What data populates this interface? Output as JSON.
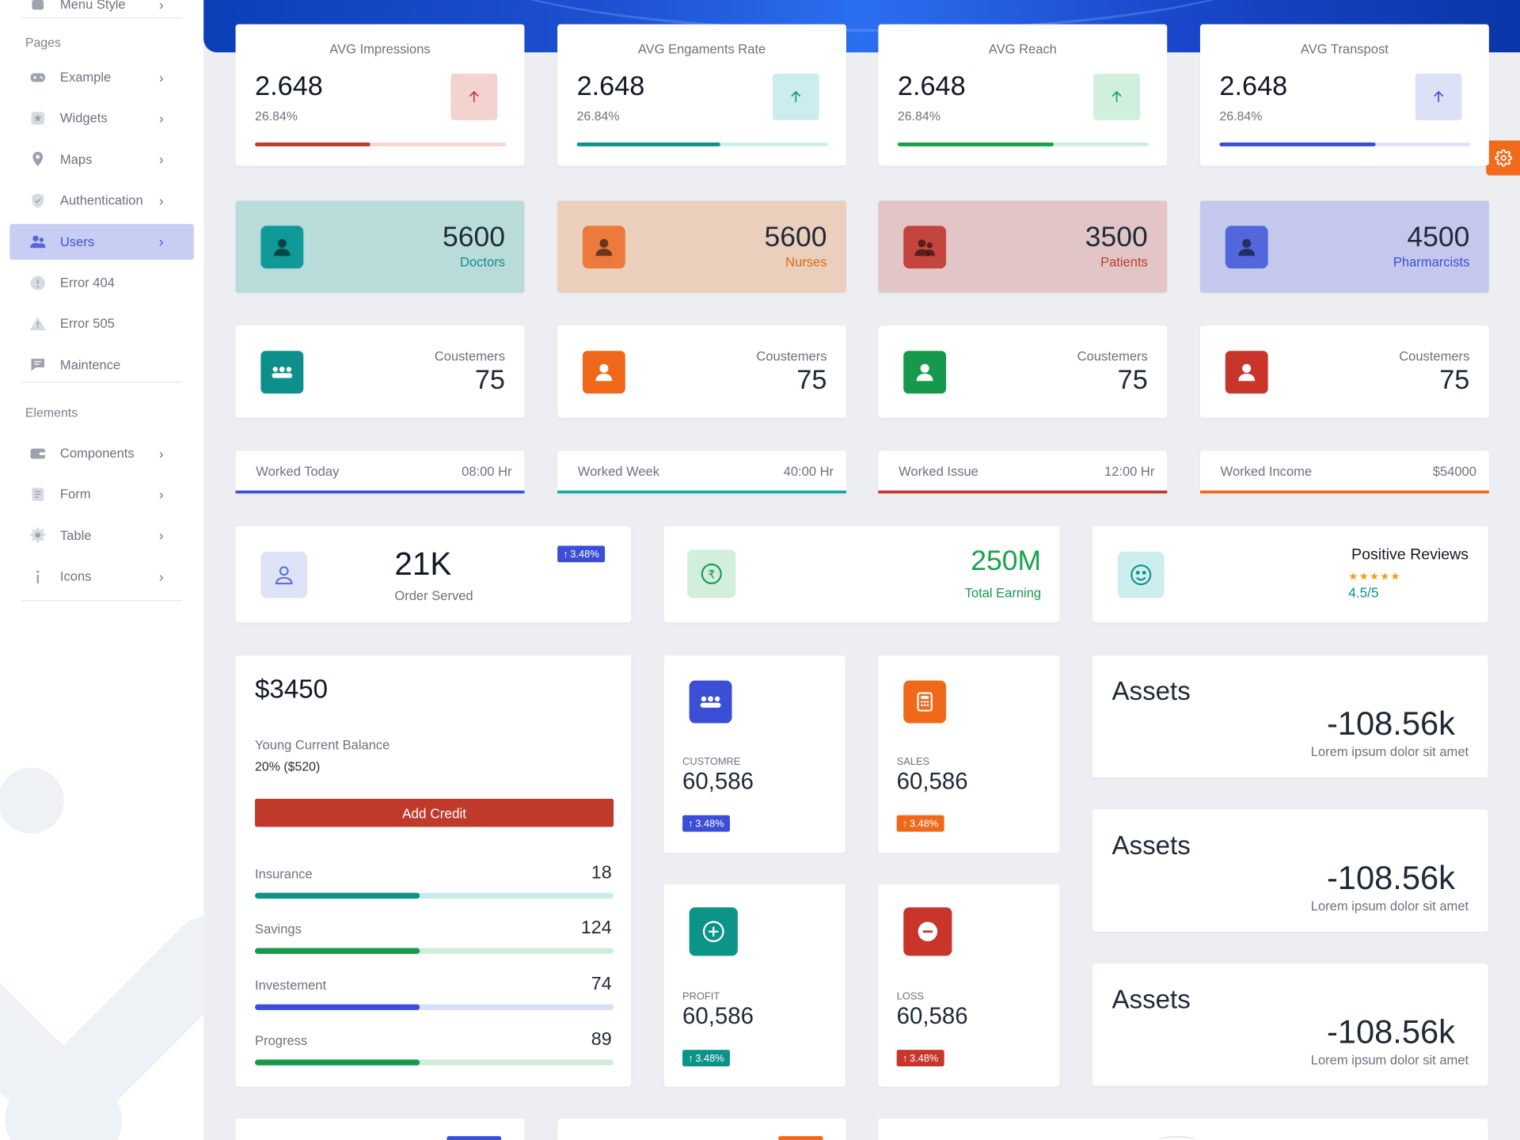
{
  "sidebar": {
    "partial_item": "Menu Style",
    "section_pages": "Pages",
    "section_elements": "Elements",
    "pages_items": [
      {
        "label": "Example",
        "icon": "gamepad-icon"
      },
      {
        "label": "Widgets",
        "icon": "star-box-icon"
      },
      {
        "label": "Maps",
        "icon": "map-pin-icon"
      },
      {
        "label": "Authentication",
        "icon": "shield-icon"
      },
      {
        "label": "Users",
        "icon": "users-icon",
        "active": true
      },
      {
        "label": "Error 404",
        "icon": "alert-circle-icon"
      },
      {
        "label": "Error 505",
        "icon": "warning-triangle-icon"
      },
      {
        "label": "Maintence",
        "icon": "chat-bubble-icon"
      }
    ],
    "element_items": [
      {
        "label": "Components",
        "icon": "wallet-icon"
      },
      {
        "label": "Form",
        "icon": "form-icon"
      },
      {
        "label": "Table",
        "icon": "gear-icon"
      },
      {
        "label": "Icons",
        "icon": "info-icon"
      }
    ]
  },
  "avg_cards": [
    {
      "title": "AVG Impressions",
      "value": "2.648",
      "percent": "26.84%",
      "progress": 0.46,
      "color": "#c0392b",
      "track": "#f6d7d2",
      "icon_bg": "#f3d3d0"
    },
    {
      "title": "AVG Engaments Rate",
      "value": "2.648",
      "percent": "26.84%",
      "progress": 0.57,
      "color": "#0d9488",
      "track": "#cdeeee",
      "icon_bg": "#cceded"
    },
    {
      "title": "AVG Reach",
      "value": "2.648",
      "percent": "26.84%",
      "progress": 0.62,
      "color": "#16a34a",
      "track": "#d0eedb",
      "icon_bg": "#d1efdd"
    },
    {
      "title": "AVG Transpost",
      "value": "2.648",
      "percent": "26.84%",
      "progress": 0.62,
      "color": "#3b4fd6",
      "track": "#dfe3f8",
      "icon_bg": "#dde1f8"
    }
  ],
  "count_cards": [
    {
      "count": "5600",
      "label": "Doctors",
      "bg": "#b9dcdb",
      "icon_bg": "#0f9a97",
      "label_color": "#0f8c8a",
      "icon": "user-icon"
    },
    {
      "count": "5600",
      "label": "Nurses",
      "bg": "#ebcfbd",
      "icon_bg": "#ec7a3d",
      "label_color": "#e2670d",
      "icon": "user-icon"
    },
    {
      "count": "3500",
      "label": "Patients",
      "bg": "#e2c6c7",
      "icon_bg": "#c4453d",
      "label_color": "#c0392b",
      "icon": "users-icon"
    },
    {
      "count": "4500",
      "label": "Pharmarcists",
      "bg": "#c3c8ec",
      "icon_bg": "#5367dd",
      "label_color": "#3b4fd6",
      "icon": "user-icon"
    }
  ],
  "customer_cards": [
    {
      "label": "Coustemers",
      "value": "75",
      "icon_bg": "#0d8f8c",
      "icon": "group-icon"
    },
    {
      "label": "Coustemers",
      "value": "75",
      "icon_bg": "#f0691a",
      "icon": "user-icon"
    },
    {
      "label": "Coustemers",
      "value": "75",
      "icon_bg": "#16994b",
      "icon": "user-icon"
    },
    {
      "label": "Coustemers",
      "value": "75",
      "icon_bg": "#c7352b",
      "icon": "user-icon"
    }
  ],
  "worked_cards": [
    {
      "label": "Worked Today",
      "value": "08:00 Hr",
      "color": "#3b4fd6"
    },
    {
      "label": "Worked Week",
      "value": "40:00 Hr",
      "color": "#17a8a8"
    },
    {
      "label": "Worked Issue",
      "value": "12:00 Hr",
      "color": "#c0392b"
    },
    {
      "label": "Worked Income",
      "value": "$54000",
      "color": "#f06a1b"
    }
  ],
  "order_card": {
    "value": "21K",
    "label": "Order Served",
    "badge": "3.48%"
  },
  "earning_card": {
    "value": "250M",
    "label": "Total Earning"
  },
  "review_card": {
    "title": "Positive Reviews",
    "stars": "★★★★★",
    "rating": "4.5/5"
  },
  "balance_card": {
    "amount": "$3450",
    "label": "Young Current Balance",
    "sub": "20% ($520)",
    "button": "Add Credit",
    "metrics": [
      {
        "label": "Insurance",
        "value": "18",
        "progress": 0.46,
        "color": "#0d9488",
        "track": "#c9ecec"
      },
      {
        "label": "Savings",
        "value": "124",
        "progress": 0.46,
        "color": "#16994b",
        "track": "#cdeedb"
      },
      {
        "label": "Investement",
        "value": "74",
        "progress": 0.46,
        "color": "#3b4fd6",
        "track": "#d8ddf8"
      },
      {
        "label": "Progress",
        "value": "89",
        "progress": 0.46,
        "color": "#16994b",
        "track": "#cdeedb"
      }
    ]
  },
  "stat_tiles": [
    {
      "caption": "CUSTOMRE",
      "value": "60,586",
      "badge": "3.48%",
      "color": "#3b4fd6",
      "icon": "group-icon"
    },
    {
      "caption": "SALES",
      "value": "60,586",
      "badge": "3.48%",
      "color": "#f0691a",
      "icon": "calculator-icon"
    },
    {
      "caption": "PROFIT",
      "value": "60,586",
      "badge": "3.48%",
      "color": "#0d9488",
      "icon": "plus-circle-icon"
    },
    {
      "caption": "Loss",
      "value": "60,586",
      "badge": "3.48%",
      "color": "#c7352b",
      "icon": "minus-circle-icon"
    }
  ],
  "assets_cards": [
    {
      "title": "Assets",
      "value": "-108.56k",
      "sub": "Lorem ipsum dolor sit amet"
    },
    {
      "title": "Assets",
      "value": "-108.56k",
      "sub": "Lorem ipsum dolor sit amet"
    },
    {
      "title": "Assets",
      "value": "-108.56k",
      "sub": "Lorem ipsum dolor sit amet"
    }
  ]
}
